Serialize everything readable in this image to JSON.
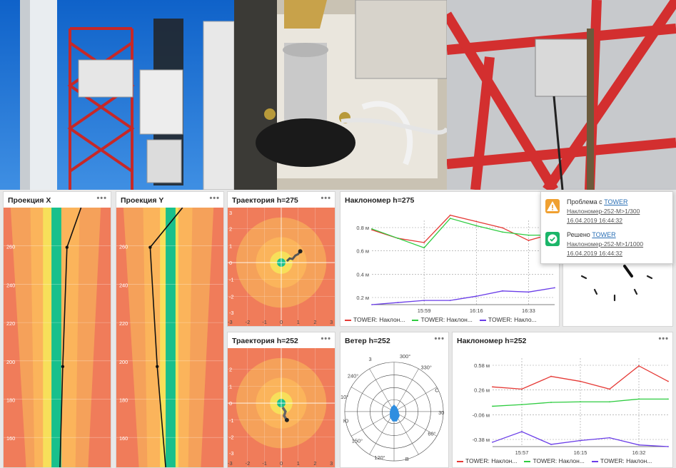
{
  "widgets": {
    "proj_x": {
      "title": "Проекция X",
      "y_ticks": [
        "260",
        "240",
        "220",
        "200",
        "180",
        "160"
      ]
    },
    "proj_y": {
      "title": "Проекция Y",
      "y_ticks": [
        "260",
        "240",
        "220",
        "200",
        "180",
        "160"
      ]
    },
    "traj275": {
      "title": "Траектория h=275",
      "y_ticks": [
        "3",
        "2",
        "1",
        "0",
        "-1",
        "-2",
        "-3"
      ],
      "x_ticks": [
        "-3",
        "-2",
        "-1",
        "0",
        "1",
        "2",
        "3"
      ]
    },
    "traj252": {
      "title": "Траектория h=252",
      "y_ticks": [
        "2",
        "1",
        "0",
        "-1",
        "-2",
        "-3"
      ],
      "x_ticks": [
        "-3",
        "-2",
        "-1",
        "0",
        "1",
        "2",
        "3"
      ]
    },
    "incl275": {
      "title": "Наклономер h=275",
      "legend": [
        "TOWER: Наклон...",
        "TOWER: Наклон...",
        "TOWER: Накло..."
      ]
    },
    "wind252": {
      "title": "Ветер h=252",
      "labels": [
        "3",
        "300°",
        "330°",
        "С",
        "30",
        "60°",
        "В",
        "120°",
        "150°",
        "Ю",
        "10°",
        "240°"
      ]
    },
    "incl252": {
      "title": "Наклономер h=252",
      "legend": [
        "TOWER: Наклон...",
        "TOWER: Наклон...",
        "TOWER: Наклон..."
      ]
    },
    "menu_label": "•••"
  },
  "notifications": [
    {
      "prefix": "Проблема с ",
      "link": "TOWER",
      "detail": "Наклономер-252-М>1/300",
      "time": "16.04.2019 16:44:32",
      "kind": "warning",
      "color": "#f0a030"
    },
    {
      "prefix": "Решено ",
      "link": "TOWER",
      "detail": "Наклономер-252-М>1/1000",
      "time": "16.04.2019 16:44:32",
      "kind": "resolved",
      "color": "#1bb569"
    }
  ],
  "chart_data": [
    {
      "type": "line",
      "title": "Наклономер h=275",
      "x": [
        "15:45",
        "15:52",
        "15:59",
        "16:08",
        "16:16",
        "16:25",
        "16:33",
        "16:41"
      ],
      "x_tick_labels": [
        "15:59",
        "16:16",
        "16:33"
      ],
      "y_tick_labels": [
        "0.8 м",
        "0.6 м",
        "0.4 м",
        "0.2 м"
      ],
      "ylim": [
        0.1,
        0.9
      ],
      "series": [
        {
          "name": "TOWER: Наклон...",
          "color": "#e53935",
          "values": [
            0.81,
            0.73,
            0.69,
            0.95,
            0.89,
            0.83,
            0.71,
            0.78
          ]
        },
        {
          "name": "TOWER: Наклон...",
          "color": "#2ecc40",
          "values": [
            0.82,
            0.73,
            0.64,
            0.92,
            0.85,
            0.79,
            0.76,
            0.76
          ]
        },
        {
          "name": "TOWER: Накло...",
          "color": "#6a3de8",
          "values": [
            0.1,
            0.12,
            0.14,
            0.14,
            0.18,
            0.23,
            0.22,
            0.26
          ]
        }
      ]
    },
    {
      "type": "line",
      "title": "Наклономер h=252",
      "x": [
        "15:48",
        "15:57",
        "16:06",
        "16:15",
        "16:24",
        "16:32",
        "16:41"
      ],
      "x_tick_labels": [
        "15:57",
        "16:15",
        "16:32"
      ],
      "y_tick_labels": [
        "0.58 м",
        "0.26 м",
        "-0.06 м",
        "-0.38 м"
      ],
      "ylim": [
        -0.6,
        1.0
      ],
      "series": [
        {
          "name": "TOWER: Наклон...",
          "color": "#e53935",
          "values": [
            0.48,
            0.44,
            0.67,
            0.58,
            0.44,
            0.86,
            0.58
          ]
        },
        {
          "name": "TOWER: Наклон...",
          "color": "#2ecc40",
          "values": [
            0.13,
            0.16,
            0.2,
            0.21,
            0.21,
            0.26,
            0.26
          ]
        },
        {
          "name": "TOWER: Наклон...",
          "color": "#6a3de8",
          "values": [
            -0.52,
            -0.33,
            -0.56,
            -0.49,
            -0.44,
            -0.57,
            -0.6
          ]
        }
      ]
    }
  ]
}
